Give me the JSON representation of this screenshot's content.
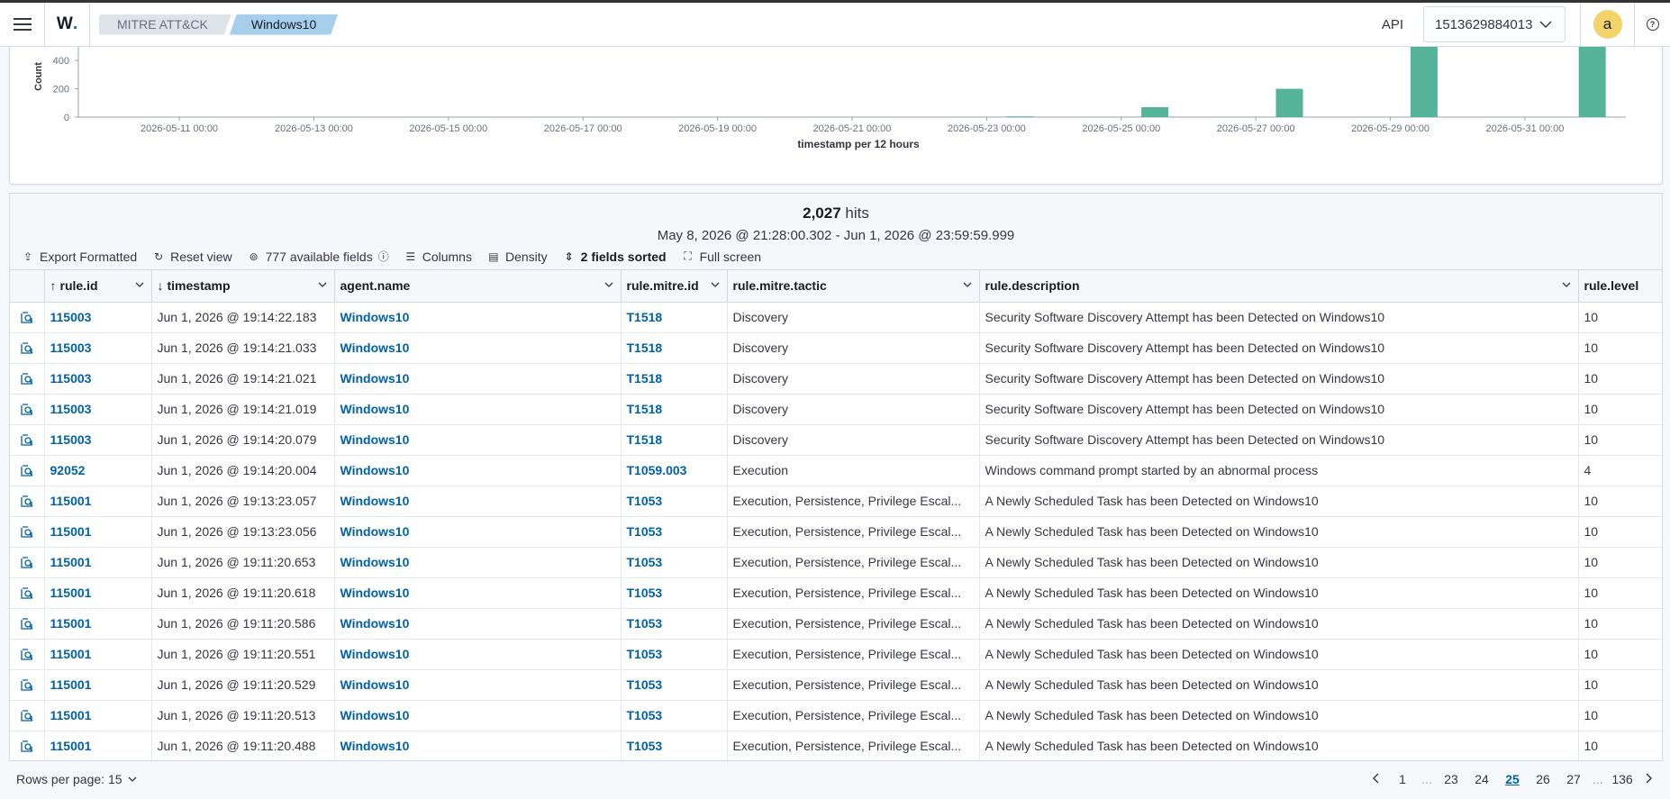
{
  "header": {
    "breadcrumbs": [
      "MITRE ATT&CK",
      "Windows10"
    ],
    "api_label": "API",
    "api_selected": "1513629884013",
    "avatar_letter": "a"
  },
  "chart_data": {
    "type": "bar",
    "xlabel": "timestamp per 12 hours",
    "ylabel": "Count",
    "x_ticks": [
      "2026-05-11 00:00",
      "2026-05-13 00:00",
      "2026-05-15 00:00",
      "2026-05-17 00:00",
      "2026-05-19 00:00",
      "2026-05-21 00:00",
      "2026-05-23 00:00",
      "2026-05-25 00:00",
      "2026-05-27 00:00",
      "2026-05-29 00:00",
      "2026-05-31 00:00"
    ],
    "y_ticks": [
      "0",
      "200",
      "400"
    ],
    "categories": [
      "2026-05-23 12:00",
      "2026-05-25 12:00",
      "2026-05-27 12:00",
      "2026-05-29 12:00",
      "2026-06-01 00:00"
    ],
    "values": [
      5,
      70,
      200,
      700,
      700
    ],
    "ylim": [
      0,
      700
    ],
    "bar_color": "#54b399"
  },
  "summary": {
    "hits_count": "2,027",
    "hits_label": "hits",
    "range": "May 8, 2026 @ 21:28:00.302 - Jun 1, 2026 @ 23:59:59.999"
  },
  "toolbar": {
    "export": "Export Formatted",
    "reset": "Reset view",
    "fields": "777 available fields",
    "columns": "Columns",
    "density": "Density",
    "sorted": "2 fields sorted",
    "fullscreen": "Full screen"
  },
  "table": {
    "columns": [
      "rule.id",
      "timestamp",
      "agent.name",
      "rule.mitre.id",
      "rule.mitre.tactic",
      "rule.description",
      "rule.level"
    ],
    "rows": [
      [
        "115003",
        "Jun 1, 2026 @ 19:14:22.183",
        "Windows10",
        "T1518",
        "Discovery",
        "Security Software Discovery Attempt has been Detected on Windows10",
        "10"
      ],
      [
        "115003",
        "Jun 1, 2026 @ 19:14:21.033",
        "Windows10",
        "T1518",
        "Discovery",
        "Security Software Discovery Attempt has been Detected on Windows10",
        "10"
      ],
      [
        "115003",
        "Jun 1, 2026 @ 19:14:21.021",
        "Windows10",
        "T1518",
        "Discovery",
        "Security Software Discovery Attempt has been Detected on Windows10",
        "10"
      ],
      [
        "115003",
        "Jun 1, 2026 @ 19:14:21.019",
        "Windows10",
        "T1518",
        "Discovery",
        "Security Software Discovery Attempt has been Detected on Windows10",
        "10"
      ],
      [
        "115003",
        "Jun 1, 2026 @ 19:14:20.079",
        "Windows10",
        "T1518",
        "Discovery",
        "Security Software Discovery Attempt has been Detected on Windows10",
        "10"
      ],
      [
        "92052",
        "Jun 1, 2026 @ 19:14:20.004",
        "Windows10",
        "T1059.003",
        "Execution",
        "Windows command prompt started by an abnormal process",
        "4"
      ],
      [
        "115001",
        "Jun 1, 2026 @ 19:13:23.057",
        "Windows10",
        "T1053",
        "Execution, Persistence, Privilege Escal...",
        "A Newly Scheduled Task has been Detected on Windows10",
        "10"
      ],
      [
        "115001",
        "Jun 1, 2026 @ 19:13:23.056",
        "Windows10",
        "T1053",
        "Execution, Persistence, Privilege Escal...",
        "A Newly Scheduled Task has been Detected on Windows10",
        "10"
      ],
      [
        "115001",
        "Jun 1, 2026 @ 19:11:20.653",
        "Windows10",
        "T1053",
        "Execution, Persistence, Privilege Escal...",
        "A Newly Scheduled Task has been Detected on Windows10",
        "10"
      ],
      [
        "115001",
        "Jun 1, 2026 @ 19:11:20.618",
        "Windows10",
        "T1053",
        "Execution, Persistence, Privilege Escal...",
        "A Newly Scheduled Task has been Detected on Windows10",
        "10"
      ],
      [
        "115001",
        "Jun 1, 2026 @ 19:11:20.586",
        "Windows10",
        "T1053",
        "Execution, Persistence, Privilege Escal...",
        "A Newly Scheduled Task has been Detected on Windows10",
        "10"
      ],
      [
        "115001",
        "Jun 1, 2026 @ 19:11:20.551",
        "Windows10",
        "T1053",
        "Execution, Persistence, Privilege Escal...",
        "A Newly Scheduled Task has been Detected on Windows10",
        "10"
      ],
      [
        "115001",
        "Jun 1, 2026 @ 19:11:20.529",
        "Windows10",
        "T1053",
        "Execution, Persistence, Privilege Escal...",
        "A Newly Scheduled Task has been Detected on Windows10",
        "10"
      ],
      [
        "115001",
        "Jun 1, 2026 @ 19:11:20.513",
        "Windows10",
        "T1053",
        "Execution, Persistence, Privilege Escal...",
        "A Newly Scheduled Task has been Detected on Windows10",
        "10"
      ],
      [
        "115001",
        "Jun 1, 2026 @ 19:11:20.488",
        "Windows10",
        "T1053",
        "Execution, Persistence, Privilege Escal...",
        "A Newly Scheduled Task has been Detected on Windows10",
        "10"
      ]
    ]
  },
  "footer": {
    "rows_per_page": "Rows per page: 15",
    "pages": [
      "1",
      "...",
      "23",
      "24",
      "25",
      "26",
      "27",
      "...",
      "136"
    ],
    "current_page": "25"
  }
}
